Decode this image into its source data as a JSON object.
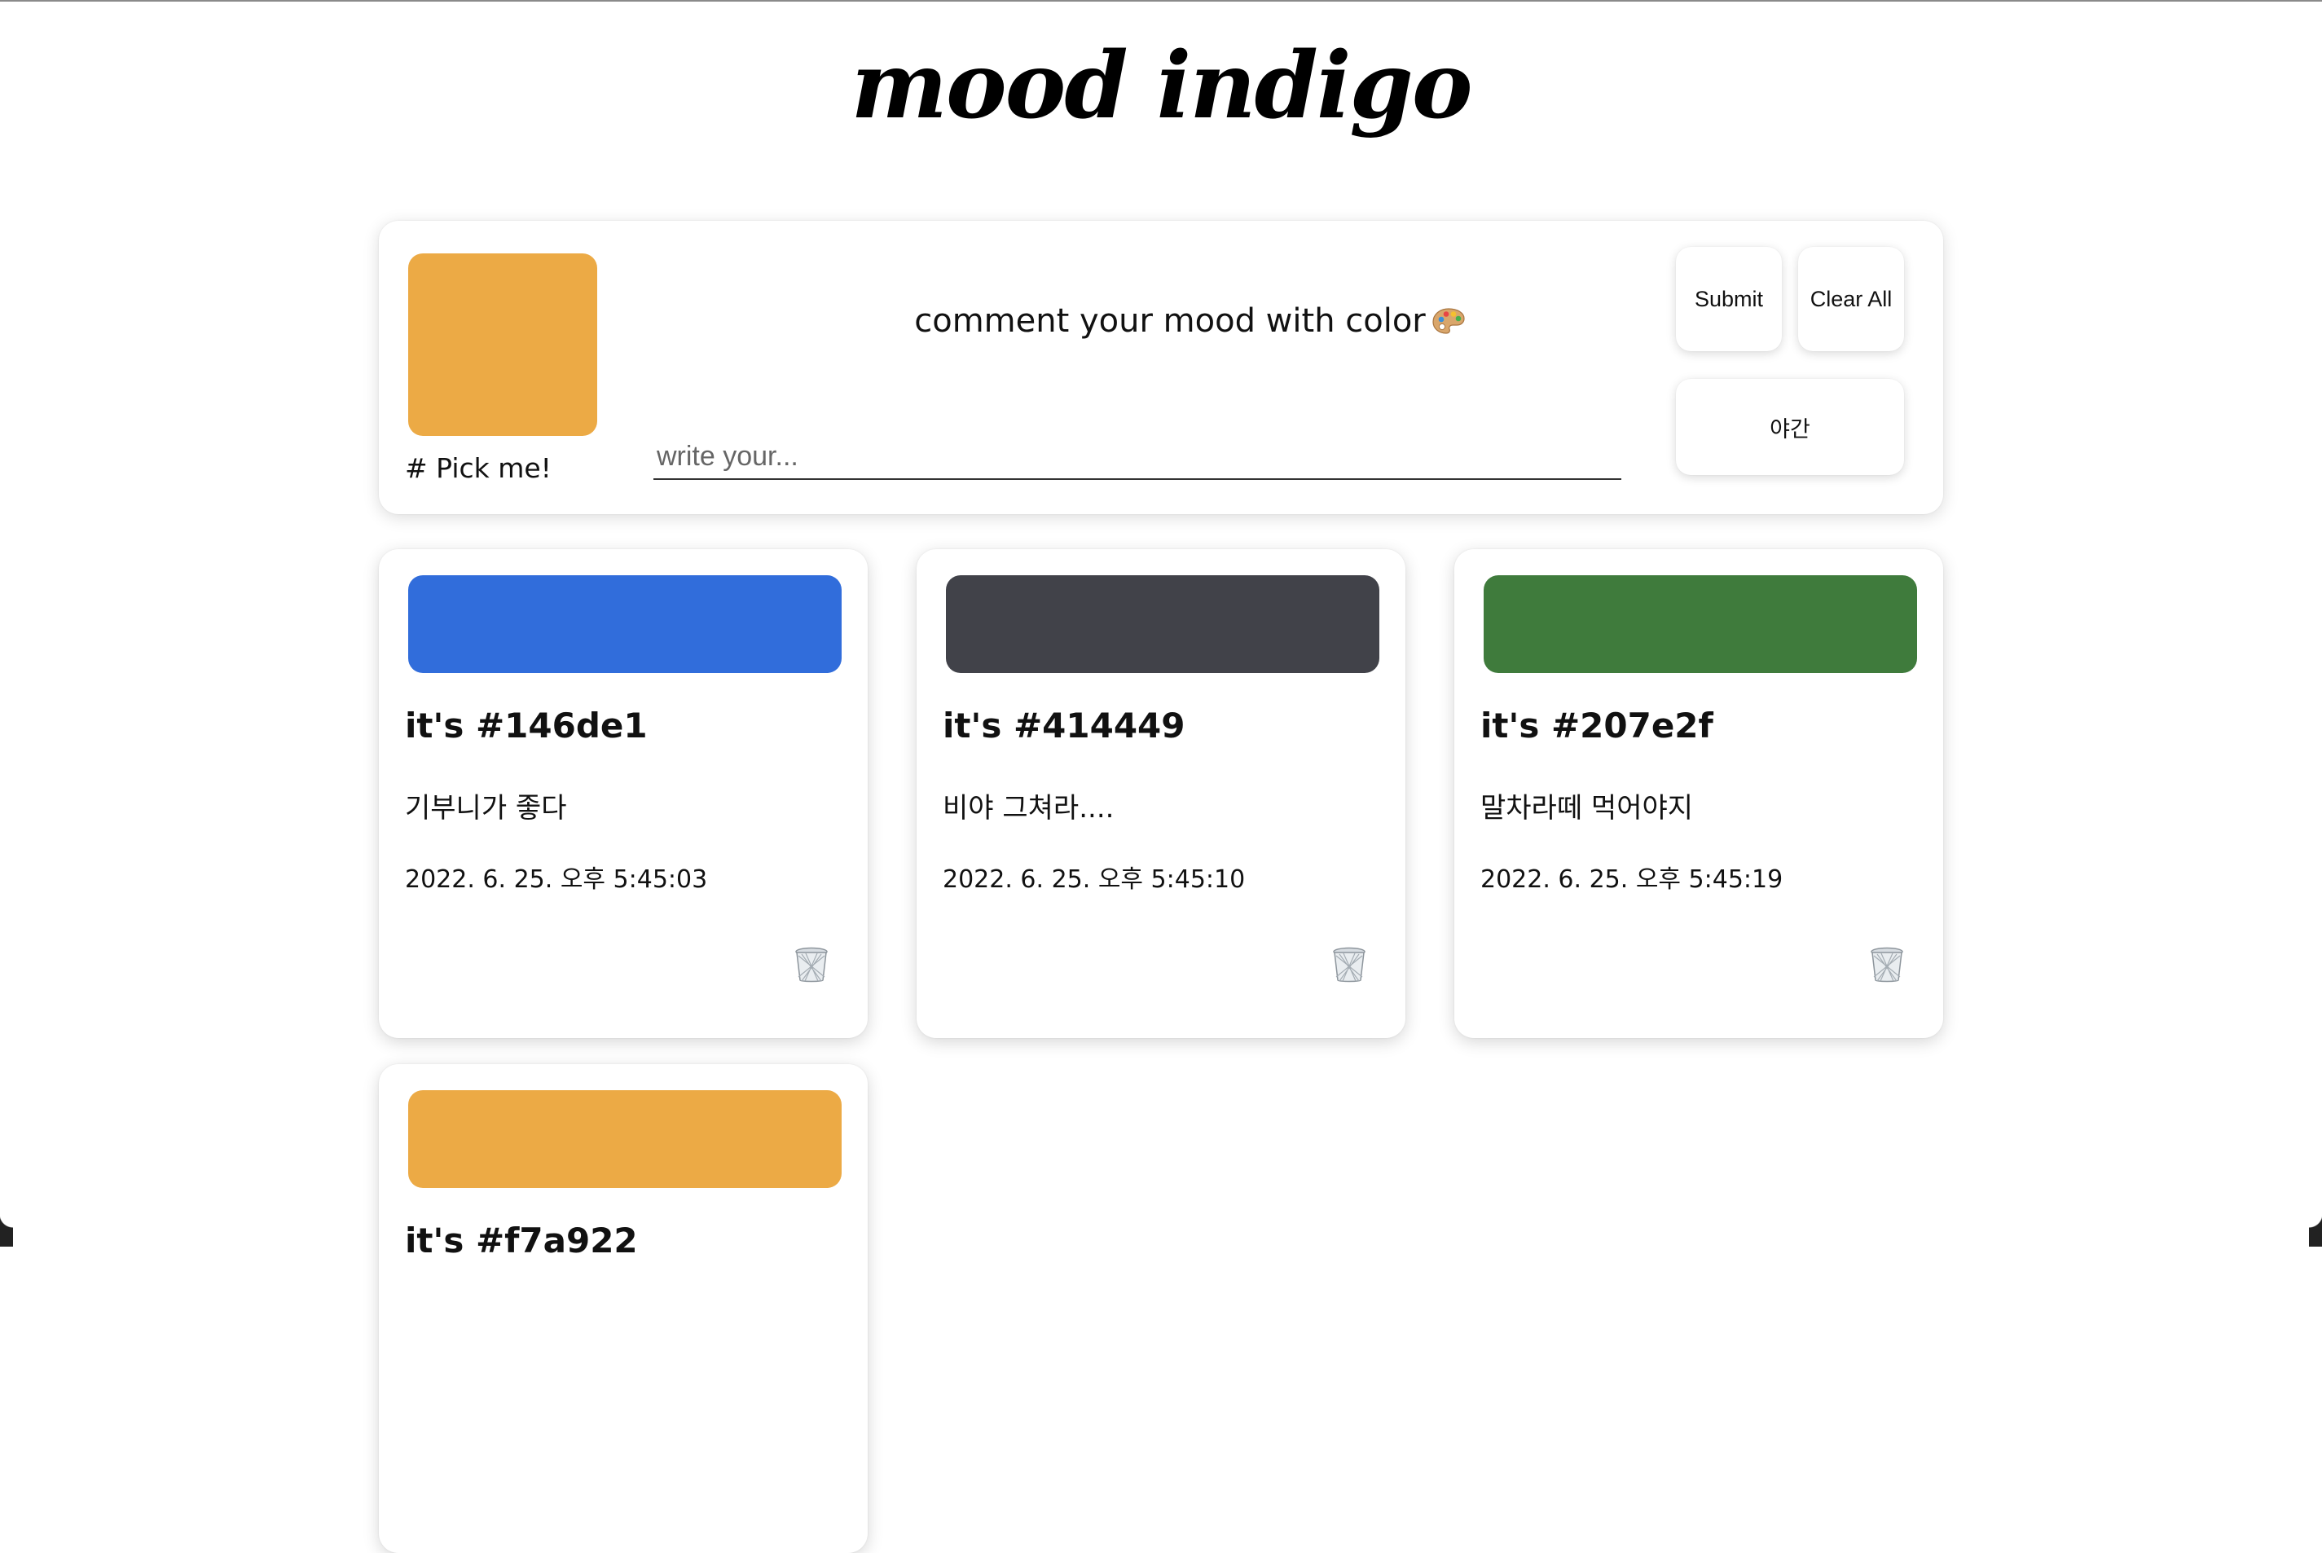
{
  "app": {
    "title": "mood indigo"
  },
  "composer": {
    "picked_color": "#ecaa45",
    "pick_label": "# Pick me!",
    "prompt": "comment your mood with color",
    "prompt_icon": "palette-icon",
    "input_placeholder": "write your...",
    "input_value": "",
    "submit_label": "Submit",
    "clear_label": "Clear All",
    "night_label": "야간"
  },
  "cards": [
    {
      "color": "#316ddb",
      "hex_label": "it's #146de1",
      "message": "기부니가 좋다",
      "timestamp": "2022. 6. 25. 오후 5:45:03",
      "delete_icon": "trash-icon"
    },
    {
      "color": "#414249",
      "hex_label": "it's #414449",
      "message": "비야 그쳐라....",
      "timestamp": "2022. 6. 25. 오후 5:45:10",
      "delete_icon": "trash-icon"
    },
    {
      "color": "#3f7b3c",
      "hex_label": "it's #207e2f",
      "message": "말차라떼 먹어야지",
      "timestamp": "2022. 6. 25. 오후 5:45:19",
      "delete_icon": "trash-icon"
    },
    {
      "color": "#ecaa45",
      "hex_label": "it's #f7a922",
      "message": "",
      "timestamp": "",
      "delete_icon": "trash-icon"
    }
  ]
}
